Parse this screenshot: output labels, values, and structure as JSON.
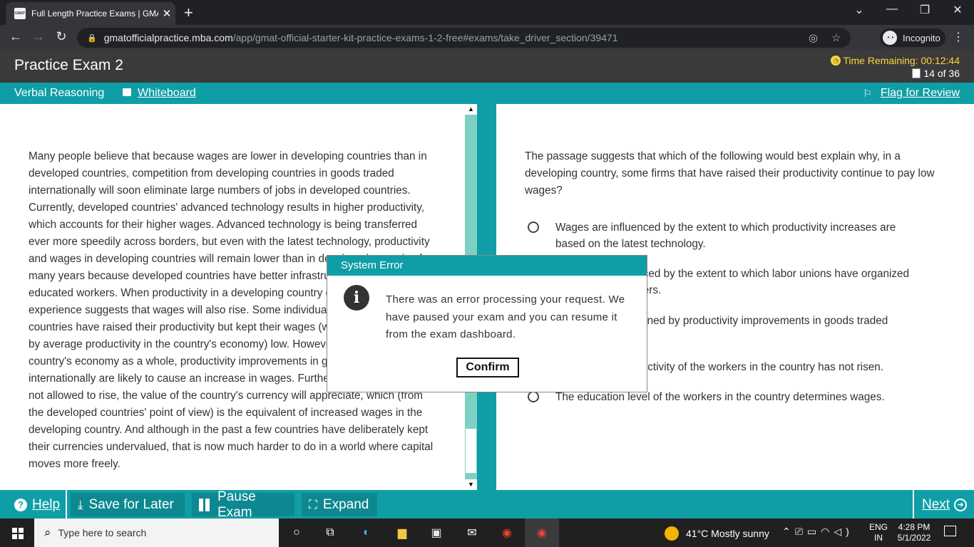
{
  "browser": {
    "tab_title": "Full Length Practice Exams | GMAT",
    "favicon_text": "GMAT",
    "url_host": "gmatofficialpractice.mba.com",
    "url_path": "/app/gmat-official-starter-kit-practice-exams-1-2-free#exams/take_driver_section/39471",
    "incognito_label": "Incognito"
  },
  "exam": {
    "title": "Practice Exam 2",
    "time_remaining": "Time Remaining: 00:12:44",
    "question_count": "14 of 36",
    "section": "Verbal Reasoning",
    "whiteboard": "Whiteboard",
    "flag_for_review": "Flag for Review"
  },
  "passage": "Many people believe that because wages are lower in developing countries than in developed countries, competition from developing countries in goods traded internationally will soon eliminate large numbers of jobs in developed countries. Currently, developed countries' advanced technology results in higher productivity, which accounts for their higher wages. Advanced technology is being transferred ever more speedily across borders, but even with the latest technology, productivity and wages in developing countries will remain lower than in developed countries for many years because developed countries have better infrastructure and better-educated workers. When productivity in a developing country does catch up, experience suggests that wages will also rise. Some individual firms in developing countries have raised their productivity but kept their wages (which are influenced by average productivity in the country's economy) low. However, in a developing country's economy as a whole, productivity improvements in goods traded internationally are likely to cause an increase in wages. Furthermore, if wages are not allowed to rise, the value of the country's currency will appreciate, which (from the developed countries' point of view) is the equivalent of increased wages in the developing country. And although in the past a few countries have deliberately kept their currencies undervalued, that is now much harder to do in a world where capital moves more freely.",
  "question": "The passage suggests that which of the following would best explain why, in a developing country, some firms that have raised their productivity continue to pay low wages?",
  "options": [
    "Wages are influenced by the extent to which productivity increases are based on the latest technology.",
    "Wages are influenced by the extent to which labor unions have organized the country's workers.",
    "Wages are determined by productivity improvements in goods traded internationally.",
    "The average productivity of the workers in the country has not risen.",
    "The education level of the workers in the country determines wages."
  ],
  "modal": {
    "title": "System Error",
    "message": "There was an error processing your request. We have paused your exam and you can resume it from the exam dashboard.",
    "confirm": "Confirm"
  },
  "bottom": {
    "help": "Help",
    "save_for_later": "Save for Later",
    "pause_exam": "Pause Exam",
    "expand": "Expand",
    "next": "Next"
  },
  "taskbar": {
    "search_placeholder": "Type here to search",
    "weather": "41°C  Mostly sunny",
    "lang_line1": "ENG",
    "lang_line2": "IN",
    "time": "4:28 PM",
    "date": "5/1/2022"
  },
  "colors": {
    "teal": "#0f9ea6",
    "header_bg": "#3a3a3a",
    "timer": "#ffd53d"
  }
}
